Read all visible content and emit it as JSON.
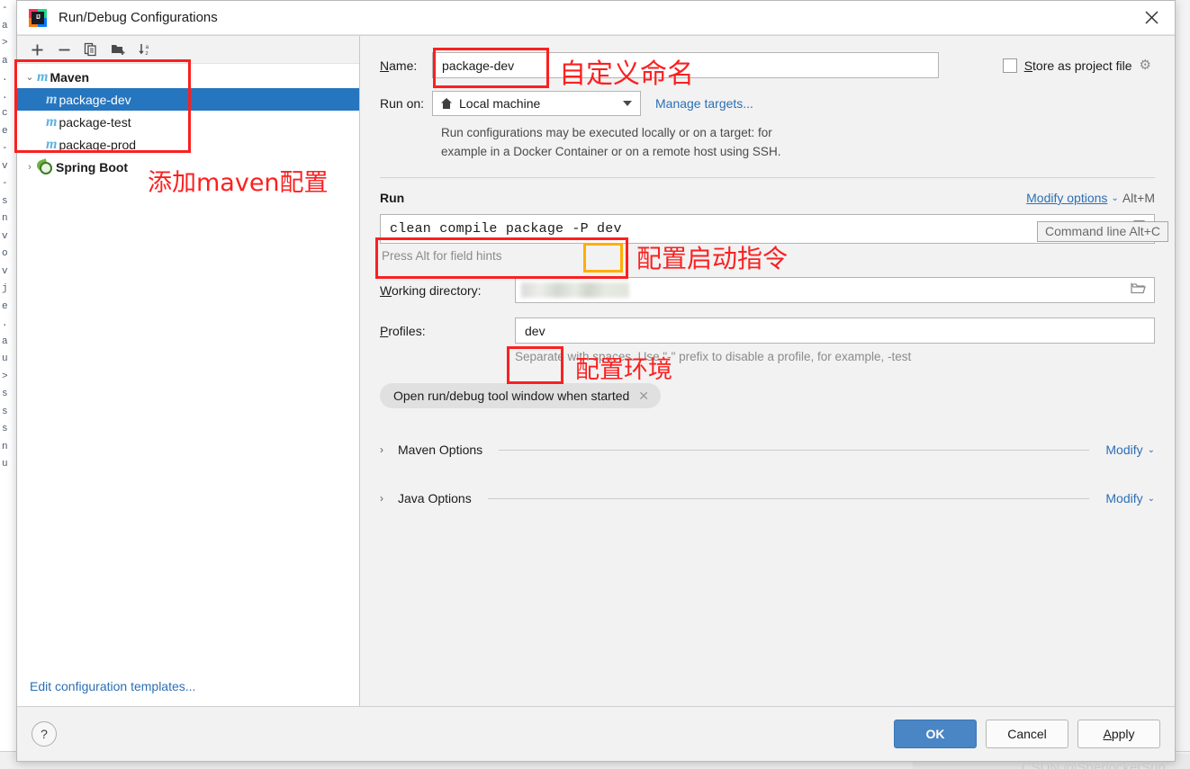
{
  "window": {
    "title": "Run/Debug Configurations",
    "app_icon": "intellij-idea-logo",
    "close_icon": "close-icon"
  },
  "background_editor": {
    "gutter_lines": [
      "-",
      "a",
      ">",
      "a",
      ".",
      ".",
      "c",
      "e",
      "-",
      "v",
      "-",
      "s",
      "n",
      "v",
      "o",
      "v",
      "j",
      "e",
      ".",
      "a",
      "u",
      ">",
      "s",
      "s",
      "s",
      "n",
      "u"
    ]
  },
  "left_pane": {
    "toolbar": [
      {
        "name": "add-configuration-button",
        "icon": "plus-icon",
        "label": "+"
      },
      {
        "name": "remove-configuration-button",
        "icon": "minus-icon",
        "label": "−"
      },
      {
        "name": "copy-configuration-button",
        "icon": "copy-icon",
        "label": "copy"
      },
      {
        "name": "new-folder-button",
        "icon": "folder-add-icon",
        "label": "folder"
      },
      {
        "name": "sort-configurations-button",
        "icon": "sort-alpha-icon",
        "label": "sort"
      }
    ],
    "tree": [
      {
        "label": "Maven",
        "icon": "maven-icon",
        "expanded": true,
        "bold": true,
        "selected": false,
        "level": 0
      },
      {
        "label": "package-dev",
        "icon": "maven-icon",
        "selected": true,
        "level": 1
      },
      {
        "label": "package-test",
        "icon": "maven-icon",
        "selected": false,
        "level": 1
      },
      {
        "label": "package-prod",
        "icon": "maven-icon",
        "selected": false,
        "level": 1
      },
      {
        "label": "Spring Boot",
        "icon": "spring-boot-icon",
        "expanded": false,
        "bold": true,
        "selected": false,
        "level": 0
      }
    ],
    "edit_templates_link": "Edit configuration templates..."
  },
  "form": {
    "name_label": "Name:",
    "name_value": "package-dev",
    "store_as_project_file_label": "Store as project file",
    "store_as_project_file_checked": false,
    "store_gear_icon": "gear-icon",
    "run_on_label": "Run on:",
    "run_on_value": "Local machine",
    "run_on_icon": "home-icon",
    "manage_targets_link": "Manage targets...",
    "run_on_hint_line1": "Run configurations may be executed locally or on a target: for",
    "run_on_hint_line2": "example in a Docker Container or on a remote host using SSH.",
    "run_section_title": "Run",
    "modify_options_label": "Modify options",
    "modify_options_shortcut": "Alt+M",
    "tooltip_text": "Command line Alt+C",
    "command_value": "clean compile package -P dev",
    "command_expand_icon": "expand-editor-icon",
    "press_alt_hint": "Press Alt for field hints",
    "working_directory_label": "Working directory:",
    "working_directory_value": "",
    "working_directory_browse_icon": "folder-icon",
    "profiles_label": "Profiles:",
    "profiles_value": "dev",
    "profiles_hint": "Separate with spaces. Use \"-\" prefix to disable a profile, for example, -test",
    "chip_label": "Open run/debug tool window when started",
    "chip_remove_icon": "close-small-icon",
    "sections": [
      {
        "name": "Maven Options",
        "modify_label": "Modify",
        "expanded": false
      },
      {
        "name": "Java Options",
        "modify_label": "Modify",
        "expanded": false
      }
    ]
  },
  "footer": {
    "help_label": "?",
    "ok_label": "OK",
    "cancel_label": "Cancel",
    "apply_label": "Apply"
  },
  "watermark": "CSDN @SherlockerSun",
  "annotations": [
    {
      "name": "annotation-maven-tree",
      "text": "添加maven配置"
    },
    {
      "name": "annotation-name",
      "text": "自定义命名"
    },
    {
      "name": "annotation-command",
      "text": "配置启动指令"
    },
    {
      "name": "annotation-profiles",
      "text": "配置环境"
    }
  ],
  "colors": {
    "selection_blue": "#2675bf",
    "link_blue": "#2b6fb5",
    "annotation_red": "#fb2020",
    "annotation_orange": "#ffae00",
    "ok_button": "#4a86c5"
  }
}
